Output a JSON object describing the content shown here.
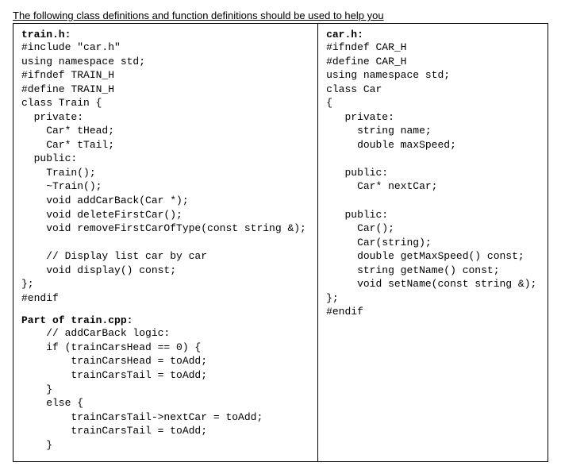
{
  "heading": "The following class definitions and function definitions should be used to help you",
  "left": {
    "file1_title": "train.h:",
    "file1_code": "#include \"car.h\"\nusing namespace std;\n#ifndef TRAIN_H\n#define TRAIN_H\nclass Train {\n  private:\n    Car* tHead;\n    Car* tTail;\n  public:\n    Train();\n    ~Train();\n    void addCarBack(Car *);\n    void deleteFirstCar();\n    void removeFirstCarOfType(const string &);\n\n    // Display list car by car\n    void display() const;\n};\n#endif",
    "file2_title": "Part of train.cpp:",
    "file2_code": "    // addCarBack logic:\n    if (trainCarsHead == 0) {\n        trainCarsHead = toAdd;\n        trainCarsTail = toAdd;\n    }\n    else {\n        trainCarsTail->nextCar = toAdd;\n        trainCarsTail = toAdd;\n    }"
  },
  "right": {
    "file1_title": "car.h:",
    "file1_code": "#ifndef CAR_H\n#define CAR_H\nusing namespace std;\nclass Car\n{\n   private:\n     string name;\n     double maxSpeed;\n\n   public:\n     Car* nextCar;\n\n   public:\n     Car();\n     Car(string);\n     double getMaxSpeed() const;\n     string getName() const;\n     void setName(const string &);\n};\n#endif"
  }
}
